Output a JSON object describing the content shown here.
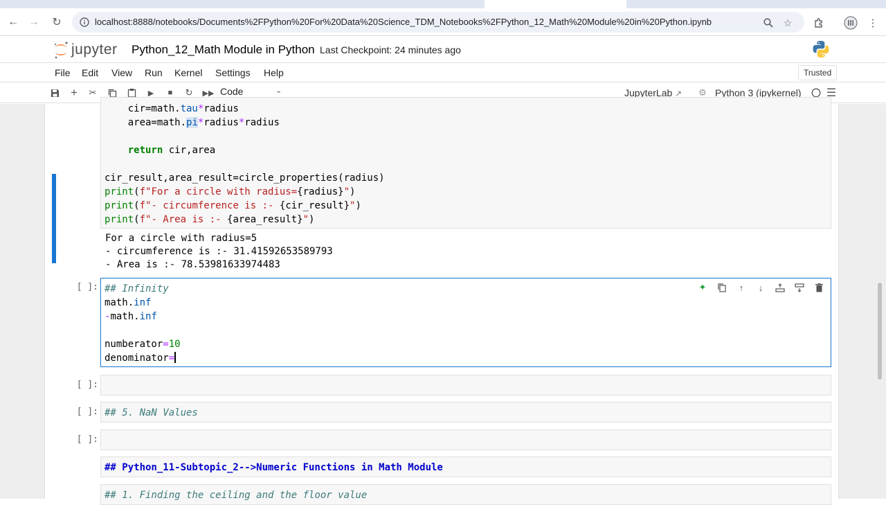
{
  "browser": {
    "url": "localhost:8888/notebooks/Documents%2FPython%20For%20Data%20Science_TDM_Notebooks%2FPython_12_Math%20Module%20in%20Python.ipynb"
  },
  "header": {
    "logo_text": "jupyter",
    "notebook_title": "Python_12_Math Module in Python",
    "checkpoint": "Last Checkpoint: 24 minutes ago"
  },
  "menubar": {
    "items": [
      "File",
      "Edit",
      "View",
      "Run",
      "Kernel",
      "Settings",
      "Help"
    ],
    "trusted": "Trusted"
  },
  "toolbar": {
    "cell_type": "Code",
    "jupyterlab_link": "JupyterLab",
    "kernel_name": "Python 3 (ipykernel)"
  },
  "cells": {
    "output1": {
      "line1": "For a circle with radius=5",
      "line2": "- circumference is :- 31.41592653589793",
      "line3": "- Area is :- 78.53981633974483"
    },
    "active_prompt": "[ ]:",
    "empty1_prompt": "[ ]:",
    "md1_prompt": "[ ]:",
    "md1_text": "## 5. NaN Values",
    "empty2_prompt": "[ ]:",
    "md2_text": "## Python_11-Subtopic_2-->Numeric Functions in Math Module",
    "md3_text": "## 1. Finding the ceiling and the floor value"
  },
  "colors": {
    "accent": "#1976d2",
    "cell_bg": "#f7f7f7"
  }
}
